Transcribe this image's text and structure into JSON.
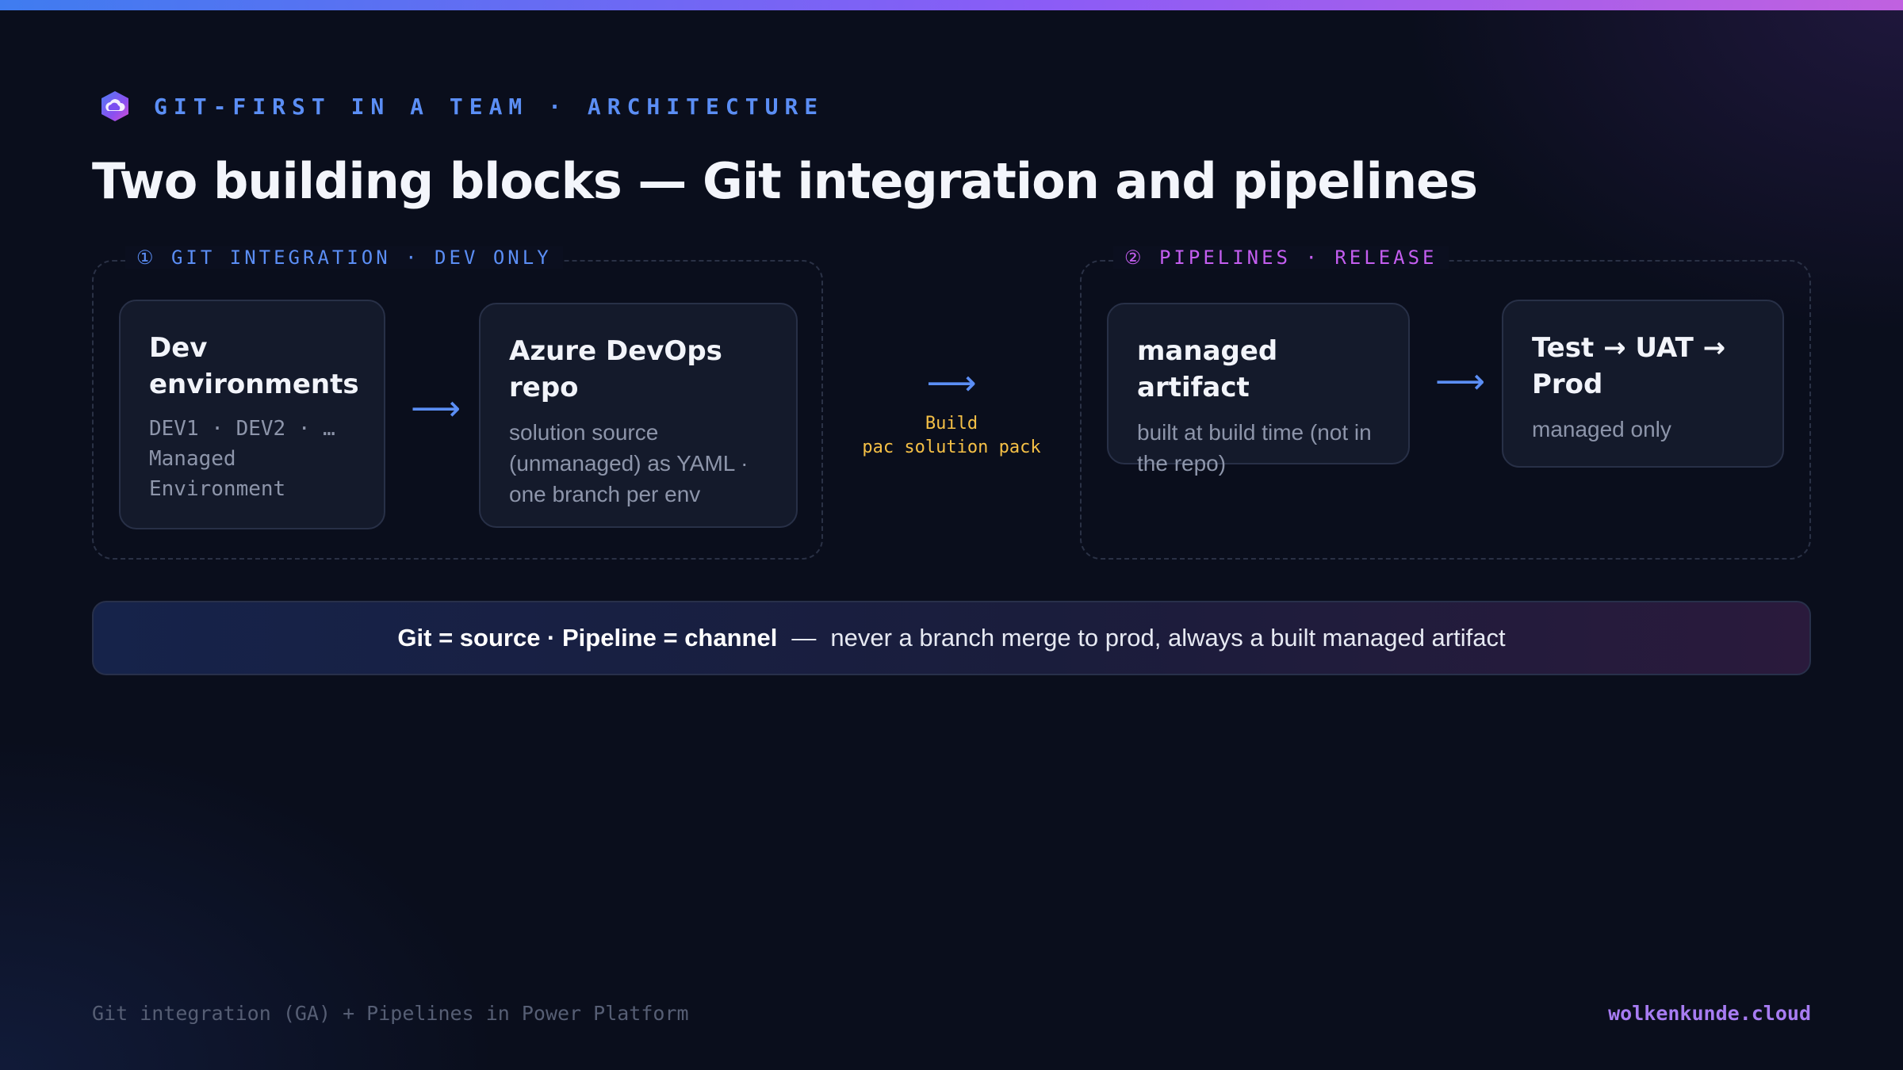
{
  "eyebrow": "GIT-FIRST IN A TEAM · ARCHITECTURE",
  "title": "Two building blocks — Git integration and pipelines",
  "git_group": {
    "label": "① GIT INTEGRATION · DEV ONLY",
    "card1": {
      "title": "Dev environments",
      "sub": "DEV1 · DEV2 · … Managed Environment"
    },
    "card2": {
      "title": "Azure DevOps repo",
      "sub": "solution source (unmanaged) as YAML · one branch per env"
    }
  },
  "build": {
    "arrow": "⟶",
    "label_line1": "Build",
    "label_line2": "pac solution pack"
  },
  "pipe_group": {
    "label": "② PIPELINES · RELEASE",
    "card1": {
      "title": "managed artifact",
      "sub": "built at build time (not in the repo)"
    },
    "card2": {
      "title": "Test → UAT → Prod",
      "sub": "managed only"
    }
  },
  "arrow_glyph": "⟶",
  "callout": {
    "strong": "Git = source · Pipeline = channel",
    "dash": "—",
    "text": "never a branch merge to prod, always a built managed artifact"
  },
  "footer": {
    "left": "Git integration (GA) + Pipelines in Power Platform",
    "right": "wolkenkunde.cloud"
  },
  "colors": {
    "background": "#0a0e1c",
    "accent_blue": "#5b8ef5",
    "accent_purple": "#c45ef0",
    "build_yellow": "#f5c046",
    "brand": "#a77cf2"
  },
  "icons": {
    "logo": "cloud-logo-icon",
    "arrow": "arrow-right-icon"
  }
}
